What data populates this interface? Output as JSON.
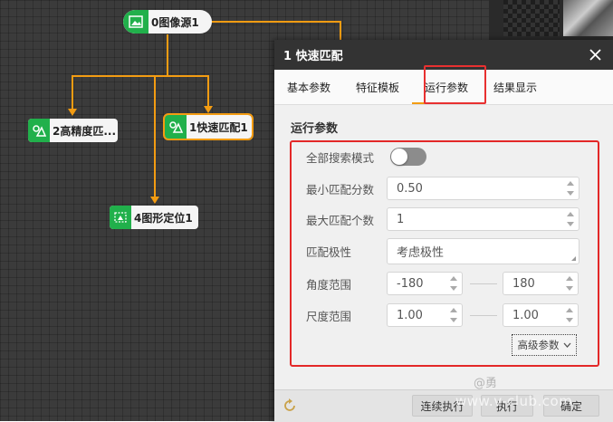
{
  "flow": {
    "nodes": [
      {
        "label": "0图像源1",
        "icon": "image-source-icon"
      },
      {
        "label": "2高精度匹...",
        "icon": "match-icon"
      },
      {
        "label": "1快速匹配1",
        "icon": "match-icon"
      },
      {
        "label": "4图形定位1",
        "icon": "locate-icon"
      }
    ]
  },
  "panel": {
    "title": "1 快速匹配",
    "tabs": [
      "基本参数",
      "特征模板",
      "运行参数",
      "结果显示"
    ],
    "active_tab": "运行参数",
    "section_title": "运行参数",
    "params": {
      "search_mode_label": "全部搜索模式",
      "search_mode_on": false,
      "min_score_label": "最小匹配分数",
      "min_score_value": "0.50",
      "max_count_label": "最大匹配个数",
      "max_count_value": "1",
      "polarity_label": "匹配极性",
      "polarity_value": "考虑极性",
      "angle_label": "角度范围",
      "angle_min": "-180",
      "angle_max": "180",
      "scale_label": "尺度范围",
      "scale_min": "1.00",
      "scale_max": "1.00"
    },
    "advanced_label": "高级参数",
    "footer": {
      "continuous_label": "连续执行",
      "run_label": "执行",
      "ok_label": "确定"
    }
  },
  "watermark": {
    "at": "@勇",
    "url": "www.v-club.com"
  },
  "colors": {
    "node_icon": "#21b04b",
    "wire": "#f39c12",
    "highlight_red": "#e32828",
    "header_bg": "#333333"
  }
}
